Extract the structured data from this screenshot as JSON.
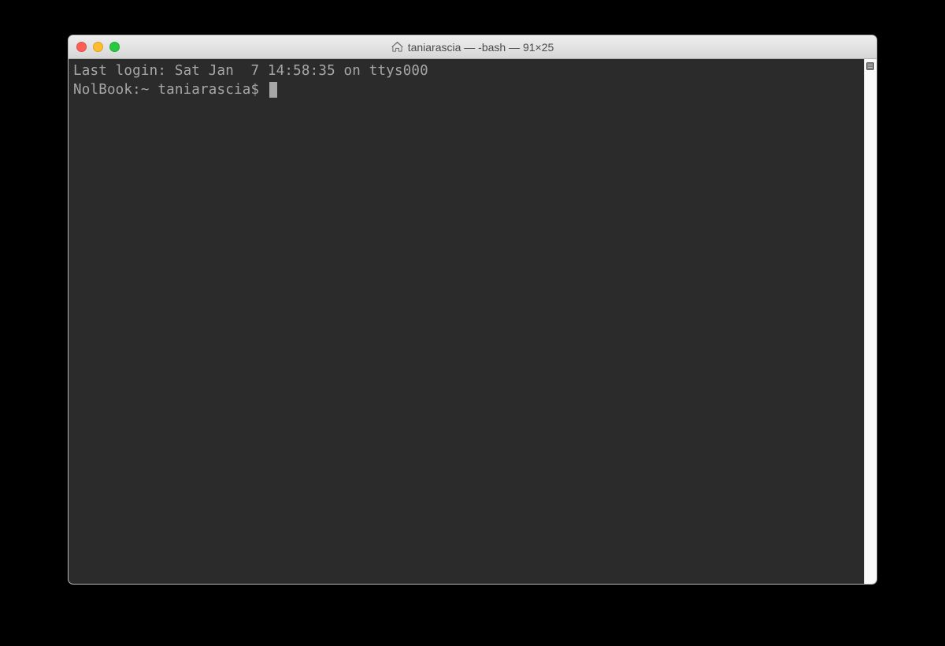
{
  "window": {
    "title": "taniarascia — -bash — 91×25"
  },
  "terminal": {
    "last_login_line": "Last login: Sat Jan  7 14:58:35 on ttys000",
    "prompt": "NolBook:~ taniarascia$ "
  },
  "colors": {
    "background": "#2b2b2b",
    "foreground": "#a7a7a7",
    "titlebar_text": "#4a4a4a"
  }
}
